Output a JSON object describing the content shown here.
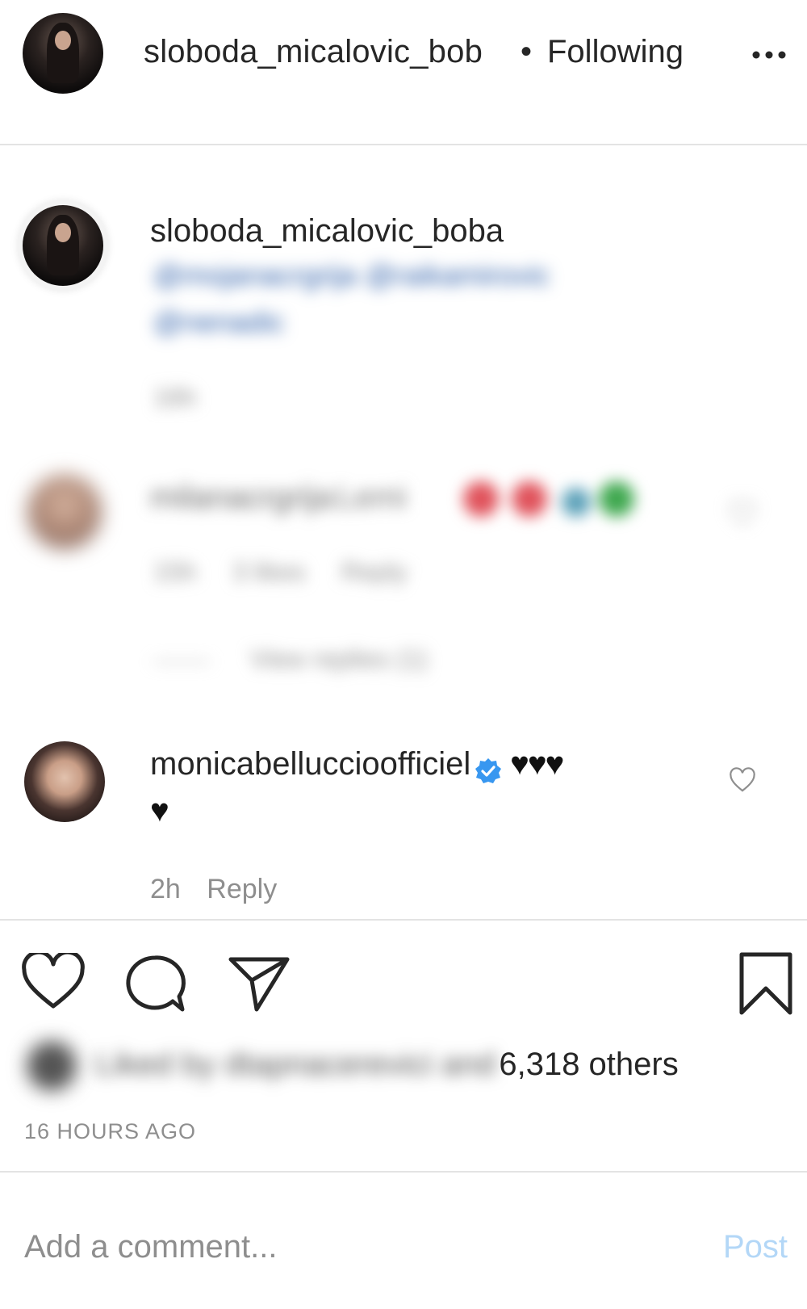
{
  "header": {
    "username": "sloboda_micalovic_bob",
    "separator": "•",
    "following_label": "Following",
    "more_icon": "more-horizontal-icon"
  },
  "caption": {
    "username": "sloboda_micalovic_boba",
    "mentions_line1": "@mojanacrgrija @raikamirovic",
    "mentions_line2": "@nenadic",
    "time": "16h"
  },
  "blurred_comment": {
    "username": "milanacrgrija",
    "text": "Lemi",
    "emojis": "❤❤🥂💚",
    "time": "15h",
    "likes": "3 likes",
    "reply_label": "Reply",
    "view_replies": "View replies (1)"
  },
  "comment": {
    "username": "monicabelluccio fficiel",
    "username_full": "monicabelluccioofficiel",
    "text_line1": "♥♥♥",
    "text_line2": "♥",
    "time": "2h",
    "reply_label": "Reply"
  },
  "actions": {
    "like_icon": "heart-icon",
    "comment_icon": "comment-icon",
    "share_icon": "paper-plane-icon",
    "save_icon": "bookmark-icon"
  },
  "likes": {
    "blurred_prefix": "Liked by dtapnacerevici and",
    "count_text": "6,318 others"
  },
  "timestamp": "16 HOURS AGO",
  "comment_box": {
    "placeholder": "Add a comment...",
    "post_label": "Post"
  },
  "colors": {
    "verified_blue": "#3897f0",
    "post_disabled": "#b3d7f7",
    "muted": "#8e8e8e"
  }
}
